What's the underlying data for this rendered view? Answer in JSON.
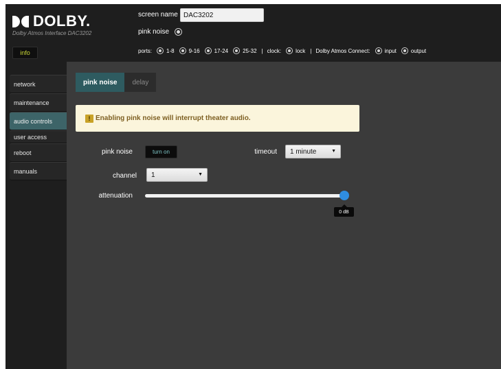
{
  "header": {
    "logo_text": "DOLBY.",
    "subtitle": "Dolby Atmos Interface DAC3202",
    "info_label": "info",
    "screen_name_label": "screen name",
    "screen_name_value": "DAC3202",
    "pink_noise_label": "pink noise",
    "ports_label": "ports:",
    "port_ranges": [
      "1-8",
      "9-16",
      "17-24",
      "25-32"
    ],
    "clock_label": "clock:",
    "lock_label": "lock",
    "atmos_connect_label": "Dolby Atmos Connect:",
    "input_label": "input",
    "output_label": "output"
  },
  "sidebar": {
    "items": [
      {
        "label": "network"
      },
      {
        "label": "maintenance"
      },
      {
        "label": "audio controls"
      },
      {
        "label": "user access"
      },
      {
        "label": "reboot"
      },
      {
        "label": "manuals"
      }
    ],
    "active_index": 2
  },
  "main": {
    "tabs": [
      {
        "label": "pink noise"
      },
      {
        "label": "delay"
      }
    ],
    "alert": {
      "icon": "!",
      "text": "Enabling pink noise will interrupt theater audio."
    },
    "pink_noise_label": "pink noise",
    "turn_on_label": "turn on",
    "timeout_label": "timeout",
    "timeout_value": "1 minute",
    "channel_label": "channel",
    "channel_value": "1",
    "attenuation_label": "attenuation",
    "attenuation_value": "0 dB",
    "attenuation_level_fraction": 1.0
  },
  "colors": {
    "accent_teal": "#2e5b60",
    "slider_blue": "#2f8de0",
    "alert_bg": "#fbf5dc",
    "alert_text": "#7d5f21",
    "info_text": "#c8d636"
  },
  "icons": {
    "select_caret": "▼"
  }
}
